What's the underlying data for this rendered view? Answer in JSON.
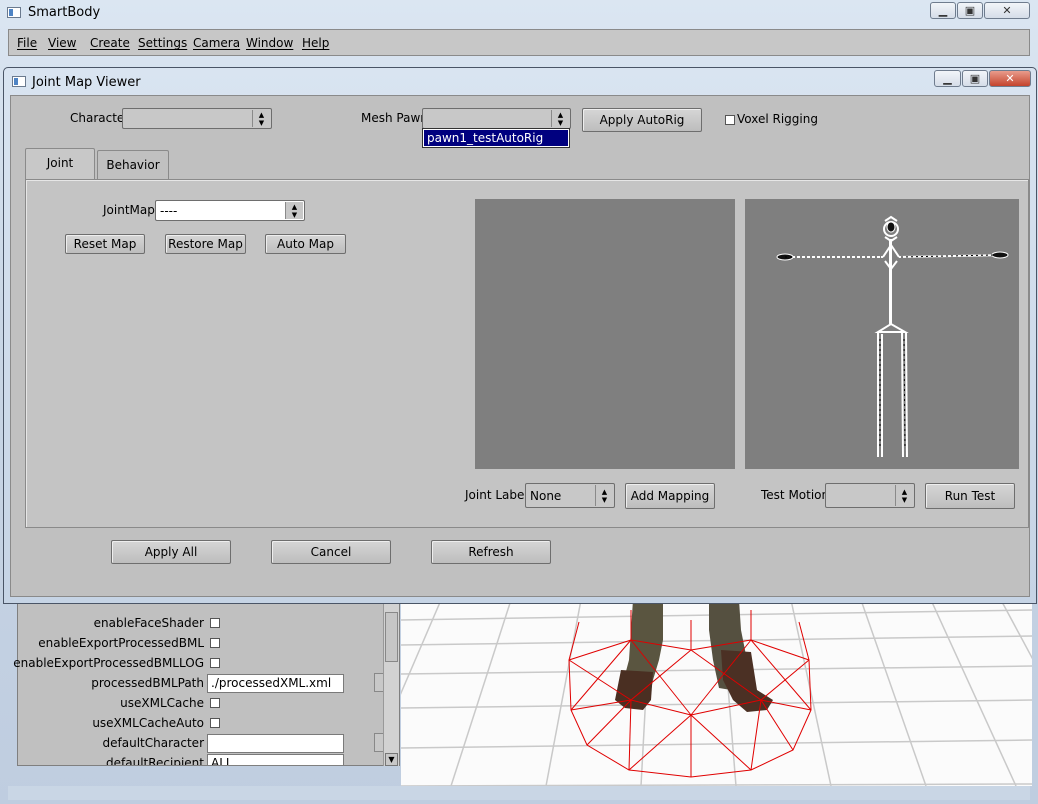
{
  "app": {
    "title": "SmartBody",
    "menu": [
      "File",
      "View",
      "Create",
      "Settings",
      "Camera",
      "Window",
      "Help"
    ]
  },
  "dialog": {
    "title": "Joint Map Viewer",
    "character_label": "Character",
    "character_value": "",
    "mesh_pawn_label": "Mesh Pawn",
    "mesh_pawn_value": "",
    "mesh_pawn_dropdown_item": "pawn1_testAutoRig",
    "apply_autorig": "Apply AutoRig",
    "voxel_rigging": "Voxel Rigging",
    "voxel_rigging_checked": false,
    "tabs": [
      "Joint Mapper",
      "Behavior Set"
    ],
    "active_tab": "Joint Mapper",
    "jointmaps_label": "JointMaps",
    "jointmaps_value": "----",
    "reset_map": "Reset Map",
    "restore_map": "Restore Map",
    "auto_map": "Auto Map",
    "joint_labels_label": "Joint Labels",
    "joint_labels_value": "None",
    "add_mapping": "Add Mapping",
    "test_motions_label": "Test Motions",
    "test_motions_value": "",
    "run_test": "Run Test",
    "apply_all": "Apply All",
    "cancel": "Cancel",
    "refresh": "Refresh"
  },
  "attributes": [
    {
      "label": "enableFaceShader",
      "type": "checkbox",
      "checked": false
    },
    {
      "label": "enableExportProcessedBML",
      "type": "checkbox",
      "checked": false
    },
    {
      "label": "enableExportProcessedBMLLOG",
      "type": "checkbox",
      "checked": false
    },
    {
      "label": "processedBMLPath",
      "type": "text",
      "value": "./processedXML.xml"
    },
    {
      "label": "useXMLCache",
      "type": "checkbox",
      "checked": false
    },
    {
      "label": "useXMLCacheAuto",
      "type": "checkbox",
      "checked": false
    },
    {
      "label": "defaultCharacter",
      "type": "text",
      "value": ""
    },
    {
      "label": "defaultRecipient",
      "type": "text",
      "value": "ALL"
    }
  ],
  "colors": {
    "viewer_bg": "#7f7f7f",
    "selection": "#00007f",
    "wireframe": "#e00000"
  }
}
